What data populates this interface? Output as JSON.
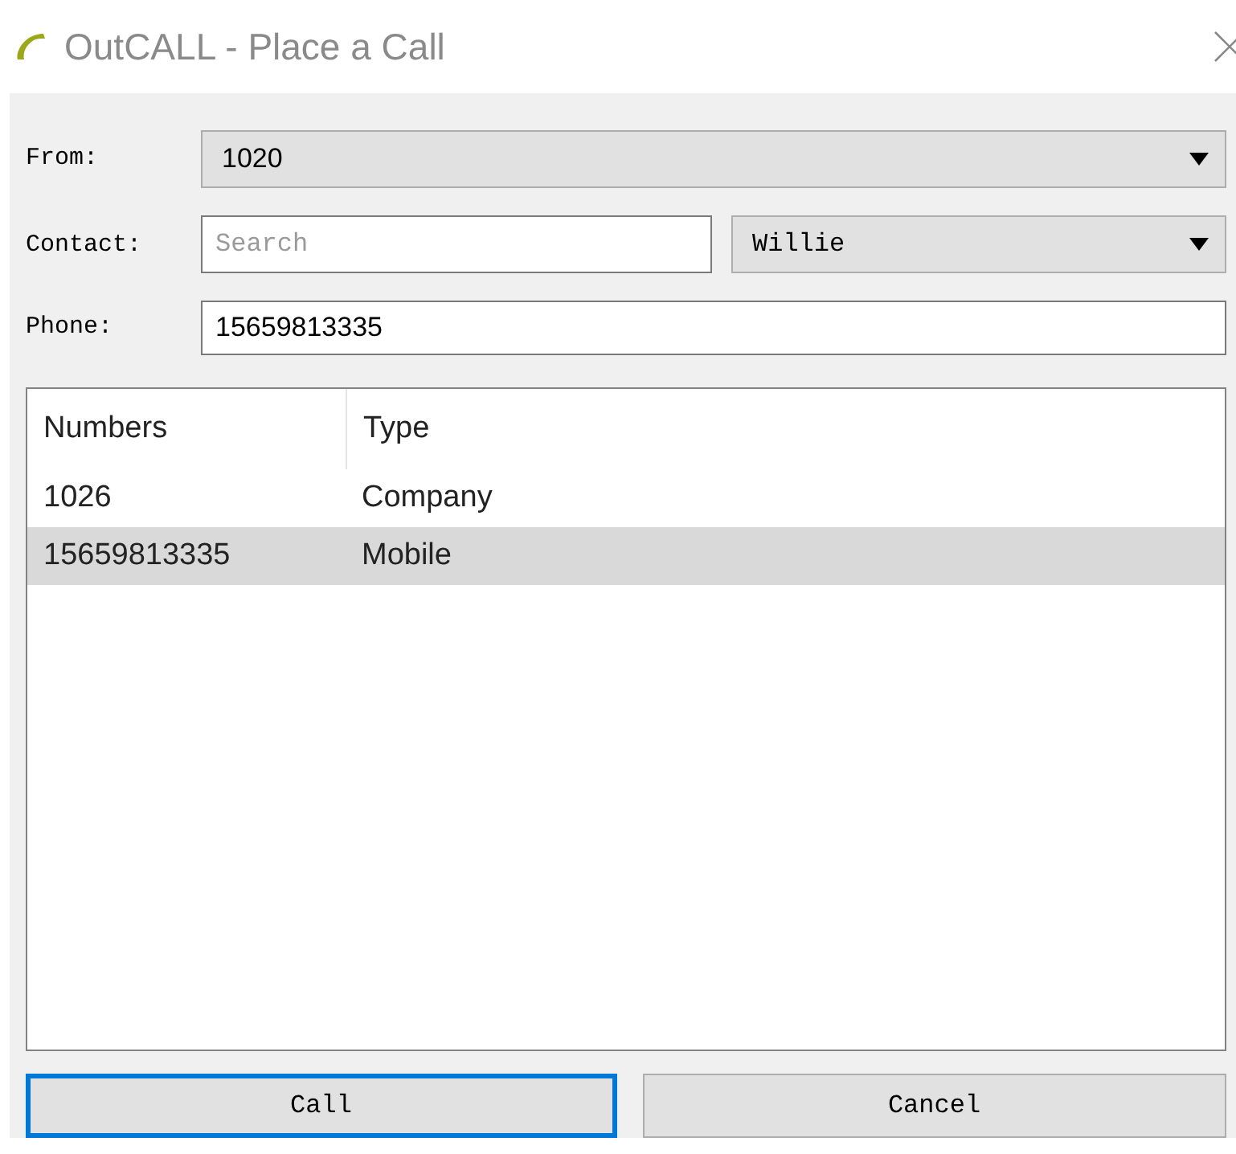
{
  "window": {
    "title": "OutCALL - Place a Call"
  },
  "from": {
    "label": "From:",
    "value": "1020"
  },
  "contact": {
    "label": "Contact:",
    "placeholder": "Search",
    "value": "Willie"
  },
  "phone": {
    "label": "Phone:",
    "value": "15659813335"
  },
  "table": {
    "columns": [
      "Numbers",
      "Type"
    ],
    "rows": [
      {
        "cells": [
          "1026",
          "Company"
        ],
        "selected": false
      },
      {
        "cells": [
          "15659813335",
          "Mobile"
        ],
        "selected": true
      }
    ]
  },
  "buttons": [
    {
      "label": "Call",
      "focused": true
    },
    {
      "label": "Cancel",
      "focused": false
    }
  ]
}
